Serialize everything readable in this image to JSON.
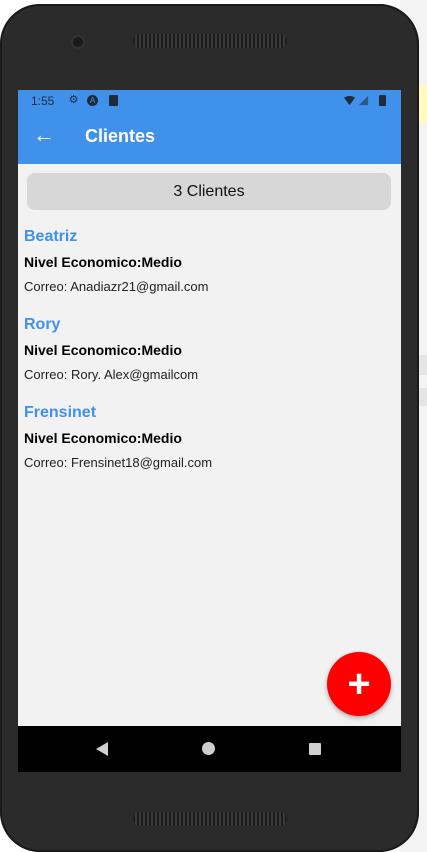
{
  "status_bar": {
    "time": "1:55"
  },
  "app_bar": {
    "title": "Clientes"
  },
  "summary": {
    "count_label": "3 Clientes"
  },
  "clients": [
    {
      "name": "Beatriz",
      "level": "Nivel Economico:Medio",
      "email": "Correo: Anadiazr21@gmail.com"
    },
    {
      "name": "Rory",
      "level": "Nivel Economico:Medio",
      "email": "Correo: Rory. Alex@gmailcom"
    },
    {
      "name": "Frensinet",
      "level": "Nivel Economico:Medio",
      "email": "Correo: Frensinet18@gmail.com"
    }
  ],
  "fab": {
    "symbol": "+"
  },
  "colors": {
    "primary": "#3f91ec",
    "fab": "#ff0000",
    "background": "#f2f2f2"
  }
}
